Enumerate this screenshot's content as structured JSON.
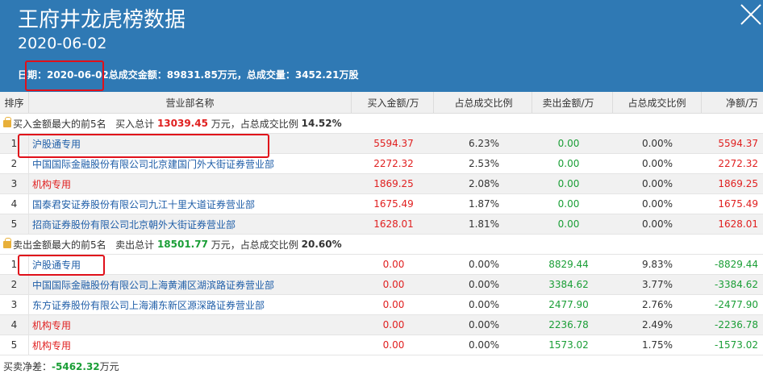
{
  "header": {
    "title": "王府井龙虎榜数据",
    "date": "2020-06-02",
    "summary": {
      "date_label": "日期：",
      "date_value": "2020-06-02",
      "turnover_label": "总成交金额：",
      "turnover_value": "89831.85万元",
      "sep": "，",
      "volume_label": "总成交量：",
      "volume_value": "3452.21万股"
    }
  },
  "columns": [
    "排序",
    "营业部名称",
    "买入金额/万",
    "占总成交比例",
    "卖出金额/万",
    "占总成交比例",
    "净额/万"
  ],
  "buy_section": {
    "prefix": "买入金额最大的前5名",
    "total_label": "买入总计",
    "total_value": "13039.45",
    "unit_text": "万元，占总成交比例",
    "ratio": "14.52%",
    "rows": [
      {
        "rank": "1",
        "name": "沪股通专用",
        "buy": "5594.37",
        "buy_pct": "6.23%",
        "sell": "0.00",
        "sell_pct": "0.00%",
        "net": "5594.37"
      },
      {
        "rank": "2",
        "name": "中国国际金融股份有限公司北京建国门外大街证券营业部",
        "buy": "2272.32",
        "buy_pct": "2.53%",
        "sell": "0.00",
        "sell_pct": "0.00%",
        "net": "2272.32"
      },
      {
        "rank": "3",
        "name": "机构专用",
        "buy": "1869.25",
        "buy_pct": "2.08%",
        "sell": "0.00",
        "sell_pct": "0.00%",
        "net": "1869.25"
      },
      {
        "rank": "4",
        "name": "国泰君安证券股份有限公司九江十里大道证券营业部",
        "buy": "1675.49",
        "buy_pct": "1.87%",
        "sell": "0.00",
        "sell_pct": "0.00%",
        "net": "1675.49"
      },
      {
        "rank": "5",
        "name": "招商证券股份有限公司北京朝外大街证券营业部",
        "buy": "1628.01",
        "buy_pct": "1.81%",
        "sell": "0.00",
        "sell_pct": "0.00%",
        "net": "1628.01"
      }
    ]
  },
  "sell_section": {
    "prefix": "卖出金额最大的前5名",
    "total_label": "卖出总计",
    "total_value": "18501.77",
    "unit_text": "万元，占总成交比例",
    "ratio": "20.60%",
    "rows": [
      {
        "rank": "1",
        "name": "沪股通专用",
        "buy": "0.00",
        "buy_pct": "0.00%",
        "sell": "8829.44",
        "sell_pct": "9.83%",
        "net": "-8829.44"
      },
      {
        "rank": "2",
        "name": "中国国际金融股份有限公司上海黄浦区湖滨路证券营业部",
        "buy": "0.00",
        "buy_pct": "0.00%",
        "sell": "3384.62",
        "sell_pct": "3.77%",
        "net": "-3384.62"
      },
      {
        "rank": "3",
        "name": "东方证券股份有限公司上海浦东新区源深路证券营业部",
        "buy": "0.00",
        "buy_pct": "0.00%",
        "sell": "2477.90",
        "sell_pct": "2.76%",
        "net": "-2477.90"
      },
      {
        "rank": "4",
        "name": "机构专用",
        "buy": "0.00",
        "buy_pct": "0.00%",
        "sell": "2236.78",
        "sell_pct": "2.49%",
        "net": "-2236.78"
      },
      {
        "rank": "5",
        "name": "机构专用",
        "buy": "0.00",
        "buy_pct": "0.00%",
        "sell": "1573.02",
        "sell_pct": "1.75%",
        "net": "-1573.02"
      }
    ]
  },
  "footer": {
    "label": "买卖净差：",
    "value": "-5462.32",
    "unit": "万元"
  },
  "colors": {
    "header_bg": "#2f79b4",
    "positive": "#e02020",
    "negative": "#1a9e36",
    "link": "#1f5ea8",
    "highlight": "#e0101a"
  }
}
